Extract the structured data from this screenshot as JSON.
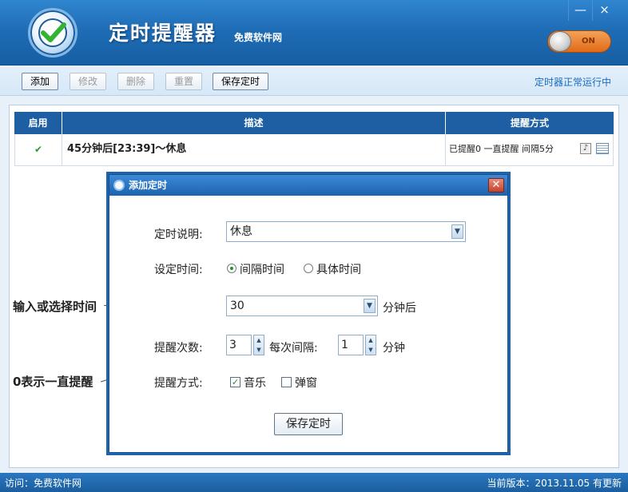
{
  "header": {
    "title": "定时提醒器",
    "subtitle": "免费软件网",
    "minimize": "—",
    "close": "×",
    "toggle_label": "ON"
  },
  "toolbar": {
    "add": "添加",
    "edit": "修改",
    "delete": "删除",
    "reset": "重置",
    "save": "保存定时",
    "status": "定时器正常运行中"
  },
  "table": {
    "columns": [
      "启用",
      "描述",
      "提醒方式"
    ],
    "rows": [
      {
        "enabled": "✔",
        "description": "45分钟后[23:39]～休息",
        "method": "已提醒0  一直提醒 间隔5分"
      }
    ]
  },
  "dialog": {
    "title": "添加定时",
    "close": "✕",
    "desc_label": "定时说明:",
    "desc_value": "休息",
    "time_label": "设定时间:",
    "radio_interval": "间隔时间",
    "radio_specific": "具体时间",
    "interval_value": "30",
    "interval_unit": "分钟后",
    "count_label": "提醒次数:",
    "count_value": "3",
    "each_interval_label": "每次间隔:",
    "each_interval_value": "1",
    "each_interval_unit": "分钟",
    "method_label": "提醒方式:",
    "music_label": "音乐",
    "popup_label": "弹窗",
    "save_button": "保存定时"
  },
  "annotations": {
    "input_time": "输入或选择时间",
    "zero_always": "0表示一直提醒"
  },
  "statusbar": {
    "visit": "访问：免费软件网",
    "version": "当前版本：2013.11.05   有更新"
  }
}
